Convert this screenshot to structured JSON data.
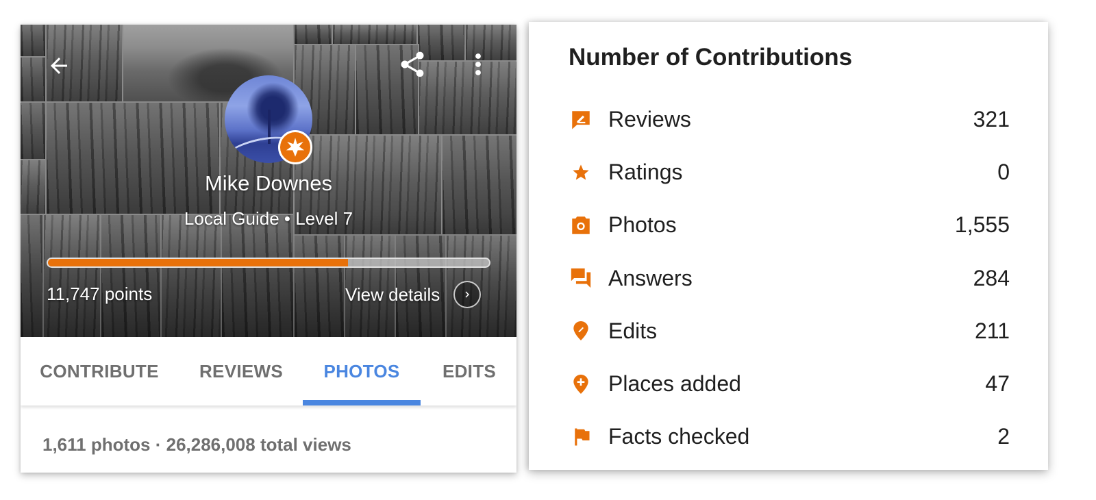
{
  "profile": {
    "name": "Mike Downes",
    "level_text": "Local Guide • Level 7",
    "points_text": "11,747 points",
    "level_progress_percent": 68,
    "view_details_label": "View details",
    "accent_color": "#e8710a"
  },
  "header_icons": {
    "back": "arrow-left-icon",
    "share": "share-icon",
    "more": "more-vert-icon"
  },
  "tabs": [
    {
      "label": "CONTRIBUTE",
      "active": false
    },
    {
      "label": "REVIEWS",
      "active": false
    },
    {
      "label": "PHOTOS",
      "active": true
    },
    {
      "label": "EDITS",
      "active": false
    }
  ],
  "tab_active_color": "#4a86e0",
  "photo_stats": "1,611 photos · 26,286,008 total views",
  "contributions": {
    "title": "Number of Contributions",
    "items": [
      {
        "icon": "review-icon",
        "label": "Reviews",
        "value": "321"
      },
      {
        "icon": "star-icon",
        "label": "Ratings",
        "value": "0"
      },
      {
        "icon": "camera-icon",
        "label": "Photos",
        "value": "1,555"
      },
      {
        "icon": "answers-icon",
        "label": "Answers",
        "value": "284"
      },
      {
        "icon": "edit-pin-icon",
        "label": "Edits",
        "value": "211"
      },
      {
        "icon": "add-place-pin-icon",
        "label": "Places added",
        "value": "47"
      },
      {
        "icon": "flag-icon",
        "label": "Facts checked",
        "value": "2"
      }
    ]
  }
}
